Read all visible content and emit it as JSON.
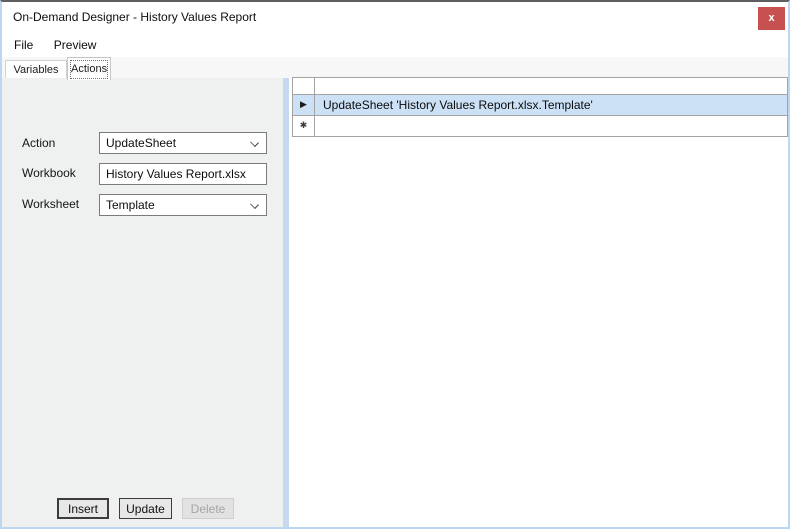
{
  "window": {
    "title": "On-Demand Designer - History Values Report",
    "close_glyph": "x"
  },
  "menu": {
    "items": [
      {
        "label": "File"
      },
      {
        "label": "Preview"
      }
    ]
  },
  "tabs": {
    "items": [
      {
        "label": "Variables",
        "selected": false
      },
      {
        "label": "Actions",
        "selected": true
      }
    ]
  },
  "form": {
    "action": {
      "label": "Action",
      "type": "dropdown",
      "value": "UpdateSheet"
    },
    "workbook": {
      "label": "Workbook",
      "type": "textbox",
      "value": "History Values Report.xlsx"
    },
    "worksheet": {
      "label": "Worksheet",
      "type": "dropdown",
      "value": "Template"
    }
  },
  "buttons": {
    "insert": {
      "label": "Insert",
      "enabled": true
    },
    "update": {
      "label": "Update",
      "enabled": true
    },
    "delete": {
      "label": "Delete",
      "enabled": false
    }
  },
  "grid": {
    "header_label": "",
    "rows": [
      {
        "indicator_glyph": "▶",
        "indicator_name": "current-row",
        "text": "UpdateSheet 'History Values Report.xlsx.Template'",
        "selected": true
      },
      {
        "indicator_glyph": "✱",
        "indicator_name": "new-row",
        "text": "",
        "selected": false
      }
    ]
  },
  "icons": {
    "close": "x-glyph",
    "chevron_down": "css-chevron",
    "current_row": "▶",
    "new_row": "✱"
  },
  "colors": {
    "close_button": "#c75050",
    "row_selection": "#cce1f6",
    "splitter": "#c5daf1",
    "left_panel": "#eff1f1",
    "title_top_border": "#5f5f5f",
    "window_border": "#bdd7f0",
    "grid_line": "#a3a3a3"
  }
}
